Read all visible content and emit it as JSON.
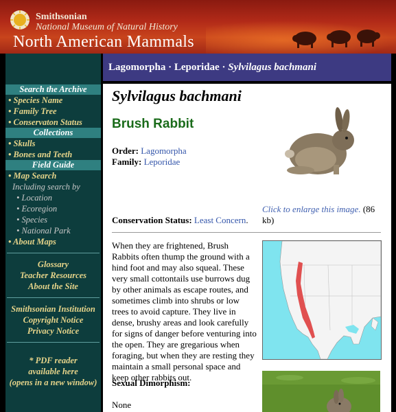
{
  "banner": {
    "institution": "Smithsonian",
    "museum": "National Museum of Natural History",
    "site_title": "North American Mammals"
  },
  "breadcrumb": {
    "order": "Lagomorpha",
    "sep1": " · ",
    "family": "Leporidae",
    "sep2": " · ",
    "species": "Sylvilagus bachmani"
  },
  "nav": {
    "search_head": "Search the Archive",
    "species_name": "• Species Name",
    "family_tree": "• Family Tree",
    "conservation": "• Conservaton Status",
    "collections_head": "Collections",
    "skulls": "• Skulls",
    "bones": "• Bones and Teeth",
    "field_head": "Field Guide",
    "map_search": "• Map Search",
    "including": "Including search by",
    "location": "• Location",
    "ecoregion": "• Ecoregion",
    "species": "• Species",
    "national_park": "• National Park",
    "about_maps": "• About Maps",
    "glossary": "Glossary",
    "teacher": "Teacher Resources",
    "about_site": "About the Site",
    "smithsonian": "Smithsonian Institution",
    "copyright": "Copyright Notice",
    "privacy": "Privacy Notice",
    "pdf1": "* PDF reader",
    "pdf2": "available here",
    "pdf3": "(opens in a new window)"
  },
  "species": {
    "scientific": "Sylvilagus bachmani",
    "common": "Brush Rabbit",
    "order_label": "Order:",
    "order_value": "Lagomorpha",
    "family_label": "Family:",
    "family_value": "Leporidae",
    "status_label": "Conservation Status:",
    "status_value": "Least Concern",
    "status_end": ".",
    "enlarge_link": "Click to enlarge this image.",
    "enlarge_size": "(86 kb)",
    "description": "When they are frightened, Brush Rabbits often thump the ground with a hind foot and may also squeal. These very small cottontails use burrows dug by other animals as escape routes, and sometimes climb into shrubs or low trees to avoid capture. They live in dense, brushy areas and look carefully for signs of danger before venturing into the open. They are gregarious when foraging, but when they are resting they maintain a small personal space and keep other rabbits out.",
    "dimorphism_label": "Sexual Dimorphism:",
    "dimorphism_value": "None"
  },
  "colors": {
    "nav_bg": "#0d3d3d",
    "nav_head": "#2f8080",
    "nav_link": "#e6d48a",
    "crumb_bg": "#3d3a82",
    "common_name": "#1a6b1a",
    "range": "#e05050"
  }
}
